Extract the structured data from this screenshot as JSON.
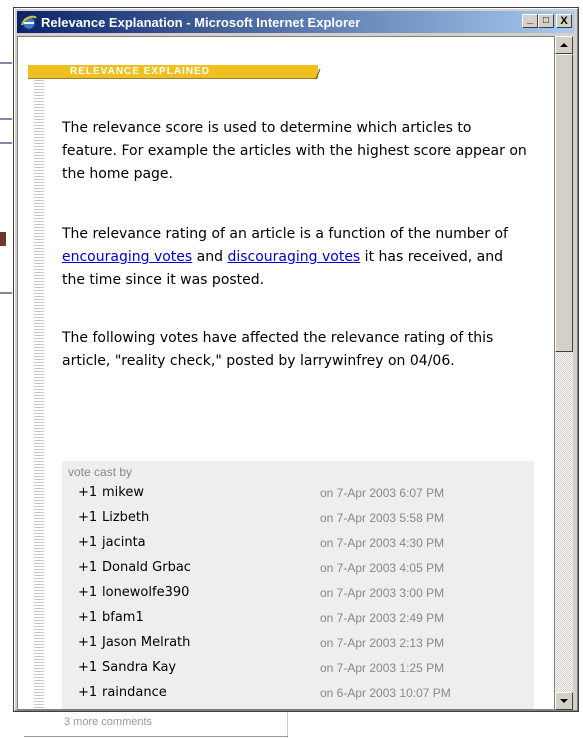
{
  "window": {
    "title": "Relevance Explanation - Microsoft Internet Explorer",
    "minimize_label": "_",
    "maximize_label": "□",
    "close_label": "X"
  },
  "page": {
    "header": "RELEVANCE EXPLAINED",
    "para1": "The relevance score is used to determine which articles to feature. For example the articles with the highest score appear on the home page.",
    "para2_pre": "The relevance rating of an article is a function of the number of ",
    "link_encouraging": "encouraging votes",
    "para2_and": " and ",
    "link_discouraging": "discouraging votes",
    "para2_post": " it has received, and the time since it was posted.",
    "para3": "The following votes have affected the relevance rating of this article, \"reality check,\" posted by larrywinfrey on 04/06."
  },
  "votes": {
    "header": "vote cast by",
    "rows": [
      {
        "value": "+1",
        "user": "mikew",
        "date": "on 7-Apr 2003 6:07 PM"
      },
      {
        "value": "+1",
        "user": "Lizbeth",
        "date": "on 7-Apr 2003 5:58 PM"
      },
      {
        "value": "+1",
        "user": "jacinta",
        "date": "on 7-Apr 2003 4:30 PM"
      },
      {
        "value": "+1",
        "user": "Donald Grbac",
        "date": "on 7-Apr 2003 4:05 PM"
      },
      {
        "value": "+1",
        "user": "lonewolfe390",
        "date": "on 7-Apr 2003 3:00 PM"
      },
      {
        "value": "+1",
        "user": "bfam1",
        "date": "on 7-Apr 2003 2:49 PM"
      },
      {
        "value": "+1",
        "user": "Jason Melrath",
        "date": "on 7-Apr 2003 2:13 PM"
      },
      {
        "value": "+1",
        "user": "Sandra Kay",
        "date": "on 7-Apr 2003 1:25 PM"
      },
      {
        "value": "+1",
        "user": "raindance",
        "date": "on 6-Apr 2003 10:07 PM"
      }
    ]
  },
  "background": {
    "bottom_text": "3 more comments"
  },
  "colors": {
    "titlebar_start": "#0a246a",
    "titlebar_end": "#a6caf0",
    "header_bar": "#f0c020",
    "link": "#0000cc",
    "votes_bg": "#eeeeee"
  }
}
